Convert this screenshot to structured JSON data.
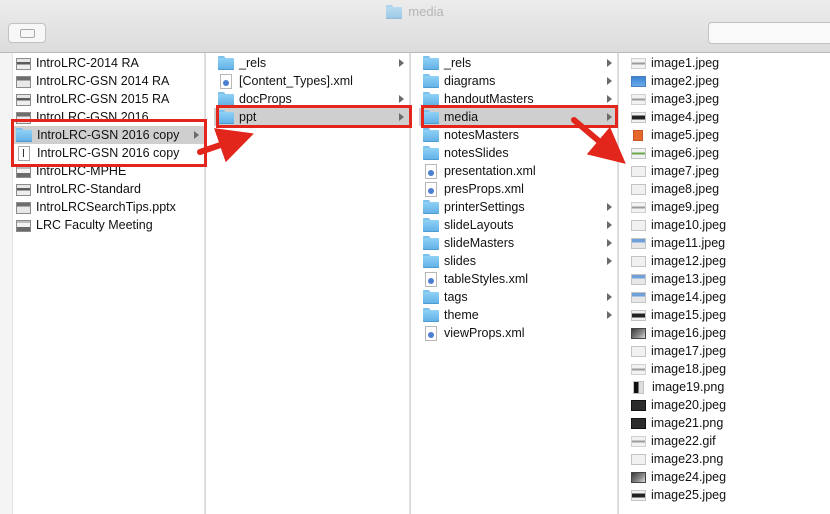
{
  "window": {
    "title": "media"
  },
  "toolbar": {
    "back_button": "back",
    "search_placeholder": ""
  },
  "columns": [
    {
      "items": [
        {
          "label": "IntroLRC-2014 RA",
          "icon": "pptx-thumbnail-icon",
          "kind": "thumb t2"
        },
        {
          "label": "IntroLRC-GSN 2014 RA",
          "icon": "pptx-thumbnail-icon",
          "kind": "thumb"
        },
        {
          "label": "IntroLRC-GSN 2015 RA",
          "icon": "pptx-thumbnail-icon",
          "kind": "thumb t2"
        },
        {
          "label": "IntroLRC-GSN 2016",
          "icon": "pptx-thumbnail-icon",
          "kind": "thumb"
        },
        {
          "label": "IntroLRC-GSN 2016 copy",
          "icon": "folder-icon",
          "kind": "folder",
          "folder": true,
          "selected": true
        },
        {
          "label": "IntroLRC-GSN 2016 copy",
          "icon": "document-icon",
          "kind": "doc"
        },
        {
          "label": "IntroLRC-MPHE",
          "icon": "pptx-thumbnail-icon",
          "kind": "thumb t3"
        },
        {
          "label": "IntroLRC-Standard",
          "icon": "pptx-thumbnail-icon",
          "kind": "thumb t2"
        },
        {
          "label": "IntroLRCSearchTips.pptx",
          "icon": "pptx-thumbnail-icon",
          "kind": "thumb"
        },
        {
          "label": "LRC Faculty Meeting",
          "icon": "pptx-thumbnail-icon",
          "kind": "thumb t3"
        }
      ]
    },
    {
      "items": [
        {
          "label": "_rels",
          "icon": "folder-icon",
          "kind": "folder",
          "folder": true
        },
        {
          "label": "[Content_Types].xml",
          "icon": "xml-file-icon",
          "kind": "xml"
        },
        {
          "label": "docProps",
          "icon": "folder-icon",
          "kind": "folder",
          "folder": true
        },
        {
          "label": "ppt",
          "icon": "folder-icon",
          "kind": "folder",
          "folder": true,
          "selected": true
        }
      ]
    },
    {
      "items": [
        {
          "label": "_rels",
          "icon": "folder-icon",
          "kind": "folder",
          "folder": true
        },
        {
          "label": "diagrams",
          "icon": "folder-icon",
          "kind": "folder",
          "folder": true
        },
        {
          "label": "handoutMasters",
          "icon": "folder-icon",
          "kind": "folder",
          "folder": true
        },
        {
          "label": "media",
          "icon": "folder-icon",
          "kind": "folder",
          "folder": true,
          "selected": true
        },
        {
          "label": "notesMasters",
          "icon": "folder-icon",
          "kind": "folder",
          "folder": true
        },
        {
          "label": "notesSlides",
          "icon": "folder-icon",
          "kind": "folder",
          "folder": true
        },
        {
          "label": "presentation.xml",
          "icon": "xml-file-icon",
          "kind": "xml"
        },
        {
          "label": "presProps.xml",
          "icon": "xml-file-icon",
          "kind": "xml"
        },
        {
          "label": "printerSettings",
          "icon": "folder-icon",
          "kind": "folder",
          "folder": true
        },
        {
          "label": "slideLayouts",
          "icon": "folder-icon",
          "kind": "folder",
          "folder": true
        },
        {
          "label": "slideMasters",
          "icon": "folder-icon",
          "kind": "folder",
          "folder": true
        },
        {
          "label": "slides",
          "icon": "folder-icon",
          "kind": "folder",
          "folder": true
        },
        {
          "label": "tableStyles.xml",
          "icon": "xml-file-icon",
          "kind": "xml"
        },
        {
          "label": "tags",
          "icon": "folder-icon",
          "kind": "folder",
          "folder": true
        },
        {
          "label": "theme",
          "icon": "folder-icon",
          "kind": "folder",
          "folder": true
        },
        {
          "label": "viewProps.xml",
          "icon": "xml-file-icon",
          "kind": "xml"
        }
      ]
    },
    {
      "items": [
        {
          "label": "image1.jpeg",
          "icon": "image-thumbnail-icon",
          "kind": "img line"
        },
        {
          "label": "image2.jpeg",
          "icon": "image-thumbnail-icon",
          "kind": "img blue"
        },
        {
          "label": "image3.jpeg",
          "icon": "image-thumbnail-icon",
          "kind": "img line"
        },
        {
          "label": "image4.jpeg",
          "icon": "image-thumbnail-icon",
          "kind": "img dark"
        },
        {
          "label": "image5.jpeg",
          "icon": "image-thumbnail-icon",
          "kind": "img orange"
        },
        {
          "label": "image6.jpeg",
          "icon": "image-thumbnail-icon",
          "kind": "img green"
        },
        {
          "label": "image7.jpeg",
          "icon": "image-thumbnail-icon",
          "kind": "img"
        },
        {
          "label": "image8.jpeg",
          "icon": "image-thumbnail-icon",
          "kind": "img"
        },
        {
          "label": "image9.jpeg",
          "icon": "image-thumbnail-icon",
          "kind": "img line"
        },
        {
          "label": "image10.jpeg",
          "icon": "image-thumbnail-icon",
          "kind": "img"
        },
        {
          "label": "image11.jpeg",
          "icon": "image-thumbnail-icon",
          "kind": "img screen"
        },
        {
          "label": "image12.jpeg",
          "icon": "image-thumbnail-icon",
          "kind": "img"
        },
        {
          "label": "image13.jpeg",
          "icon": "image-thumbnail-icon",
          "kind": "img screen"
        },
        {
          "label": "image14.jpeg",
          "icon": "image-thumbnail-icon",
          "kind": "img screen"
        },
        {
          "label": "image15.jpeg",
          "icon": "image-thumbnail-icon",
          "kind": "img dark"
        },
        {
          "label": "image16.jpeg",
          "icon": "image-thumbnail-icon",
          "kind": "img photo"
        },
        {
          "label": "image17.jpeg",
          "icon": "image-thumbnail-icon",
          "kind": "img"
        },
        {
          "label": "image18.jpeg",
          "icon": "image-thumbnail-icon",
          "kind": "img line"
        },
        {
          "label": "image19.png",
          "icon": "image-thumbnail-icon",
          "kind": "img blk2"
        },
        {
          "label": "image20.jpeg",
          "icon": "image-thumbnail-icon",
          "kind": "img black"
        },
        {
          "label": "image21.png",
          "icon": "image-thumbnail-icon",
          "kind": "img black"
        },
        {
          "label": "image22.gif",
          "icon": "image-thumbnail-icon",
          "kind": "img line"
        },
        {
          "label": "image23.png",
          "icon": "image-thumbnail-icon",
          "kind": "img"
        },
        {
          "label": "image24.jpeg",
          "icon": "image-thumbnail-icon",
          "kind": "img photo"
        },
        {
          "label": "image25.jpeg",
          "icon": "image-thumbnail-icon",
          "kind": "img dark"
        }
      ]
    }
  ],
  "colors": {
    "highlight": "#e2261b",
    "folder": "#6cbcf0",
    "selection": "#cfcfcf"
  }
}
